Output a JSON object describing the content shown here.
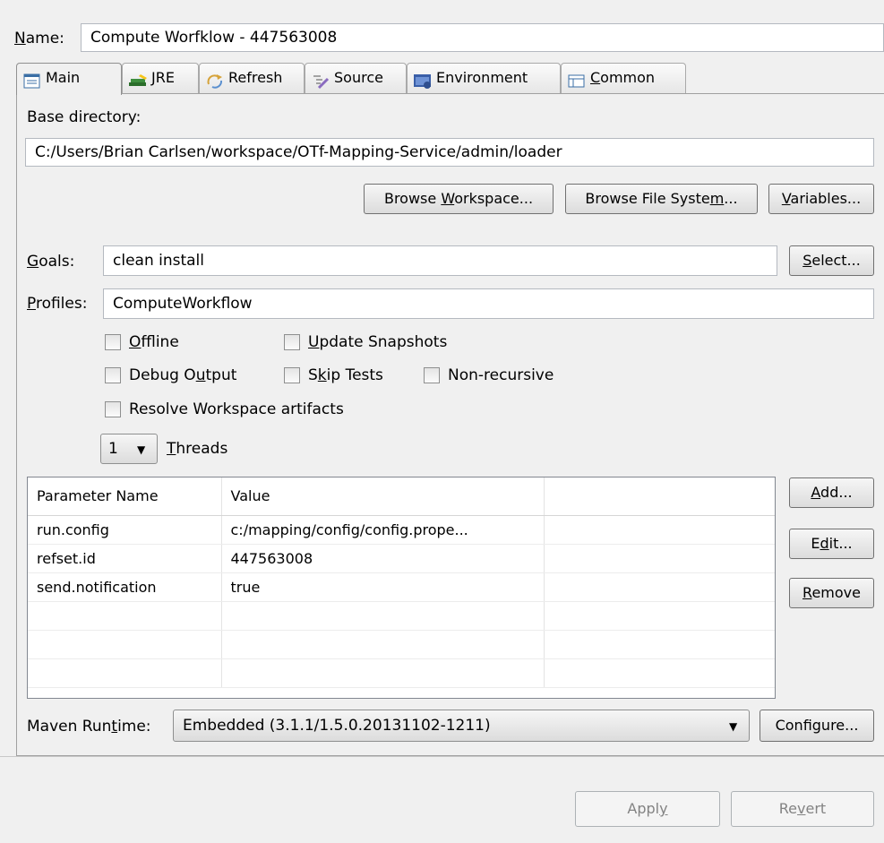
{
  "name": {
    "label_prefix": "N",
    "label_rest": "ame:",
    "value": "Compute Worfklow - 447563008"
  },
  "tabs": [
    {
      "label": "Main",
      "icon": "main-tab-icon"
    },
    {
      "label": "JRE",
      "icon": "jre-books-icon"
    },
    {
      "label": "Refresh",
      "icon": "refresh-icon"
    },
    {
      "label": "Source",
      "icon": "source-icon"
    },
    {
      "label": "Environment",
      "icon": "environment-icon"
    },
    {
      "label_ul": "C",
      "label_rest": "ommon",
      "icon": "common-icon"
    }
  ],
  "base_directory": {
    "label": "Base directory:",
    "value": "C:/Users/Brian Carlsen/workspace/OTf-Mapping-Service/admin/loader",
    "browse_workspace": {
      "a": "Browse ",
      "ul": "W",
      "b": "orkspace..."
    },
    "browse_file_system": {
      "a": "Browse File Syste",
      "ul": "m",
      "b": "..."
    },
    "variables": {
      "a": "",
      "ul": "V",
      "b": "ariables..."
    }
  },
  "goals": {
    "ul": "G",
    "rest": "oals:",
    "value": "clean install",
    "select": {
      "ul": "S",
      "rest": "elect..."
    }
  },
  "profiles": {
    "ul": "P",
    "rest": "rofiles:",
    "value": "ComputeWorkflow"
  },
  "options": {
    "offline": {
      "ul": "O",
      "rest": "ffline",
      "checked": false
    },
    "update_snapshots": {
      "ul": "U",
      "rest": "pdate Snapshots",
      "checked": false
    },
    "debug_output": {
      "a": "Debug O",
      "ul": "u",
      "b": "tput",
      "checked": false
    },
    "skip_tests": {
      "a": "S",
      "ul": "k",
      "b": "ip Tests",
      "checked": false
    },
    "non_recursive": {
      "label": "Non-recursive",
      "checked": false
    },
    "resolve_workspace": {
      "label": "Resolve Workspace artifacts",
      "checked": false
    }
  },
  "threads": {
    "value": "1",
    "ul": "T",
    "rest": "hreads"
  },
  "parameters": {
    "columns": [
      "Parameter Name",
      "Value",
      ""
    ],
    "rows": [
      [
        "run.config",
        "c:/mapping/config/config.prope..."
      ],
      [
        "refset.id",
        "447563008"
      ],
      [
        "send.notification",
        "true"
      ],
      [
        "",
        ""
      ],
      [
        "",
        ""
      ],
      [
        "",
        ""
      ]
    ],
    "add": {
      "ul": "A",
      "rest": "dd..."
    },
    "edit": {
      "a": "E",
      "ul": "d",
      "b": "it..."
    },
    "remove": {
      "ul": "R",
      "rest": "emove"
    }
  },
  "maven_runtime": {
    "label_a": "Maven Run",
    "label_ul": "t",
    "label_b": "ime:",
    "value": "Embedded (3.1.1/1.5.0.20131102-1211)",
    "configure": "Configure..."
  },
  "footer": {
    "apply": {
      "a": "Appl",
      "ul": "y",
      "b": ""
    },
    "revert": {
      "a": "Re",
      "ul": "v",
      "b": "ert"
    }
  },
  "colors": {
    "panel": "#f0f0f0",
    "border": "#a0a0a0",
    "field_border": "#b4b9c0"
  }
}
